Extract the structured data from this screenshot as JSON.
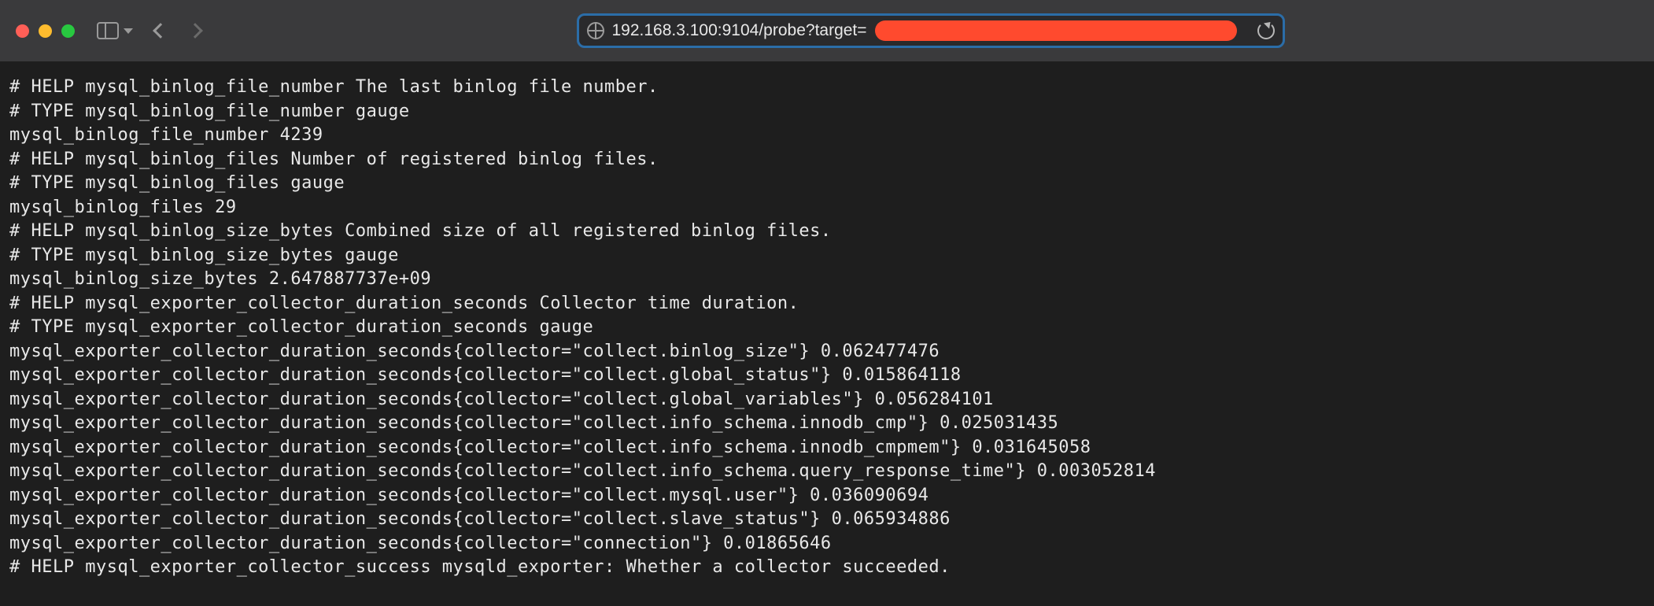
{
  "url": "192.168.3.100:9104/probe?target=",
  "metrics_lines": [
    "# HELP mysql_binlog_file_number The last binlog file number.",
    "# TYPE mysql_binlog_file_number gauge",
    "mysql_binlog_file_number 4239",
    "# HELP mysql_binlog_files Number of registered binlog files.",
    "# TYPE mysql_binlog_files gauge",
    "mysql_binlog_files 29",
    "# HELP mysql_binlog_size_bytes Combined size of all registered binlog files.",
    "# TYPE mysql_binlog_size_bytes gauge",
    "mysql_binlog_size_bytes 2.647887737e+09",
    "# HELP mysql_exporter_collector_duration_seconds Collector time duration.",
    "# TYPE mysql_exporter_collector_duration_seconds gauge",
    "mysql_exporter_collector_duration_seconds{collector=\"collect.binlog_size\"} 0.062477476",
    "mysql_exporter_collector_duration_seconds{collector=\"collect.global_status\"} 0.015864118",
    "mysql_exporter_collector_duration_seconds{collector=\"collect.global_variables\"} 0.056284101",
    "mysql_exporter_collector_duration_seconds{collector=\"collect.info_schema.innodb_cmp\"} 0.025031435",
    "mysql_exporter_collector_duration_seconds{collector=\"collect.info_schema.innodb_cmpmem\"} 0.031645058",
    "mysql_exporter_collector_duration_seconds{collector=\"collect.info_schema.query_response_time\"} 0.003052814",
    "mysql_exporter_collector_duration_seconds{collector=\"collect.mysql.user\"} 0.036090694",
    "mysql_exporter_collector_duration_seconds{collector=\"collect.slave_status\"} 0.065934886",
    "mysql_exporter_collector_duration_seconds{collector=\"connection\"} 0.01865646",
    "# HELP mysql_exporter_collector_success mysqld_exporter: Whether a collector succeeded."
  ]
}
